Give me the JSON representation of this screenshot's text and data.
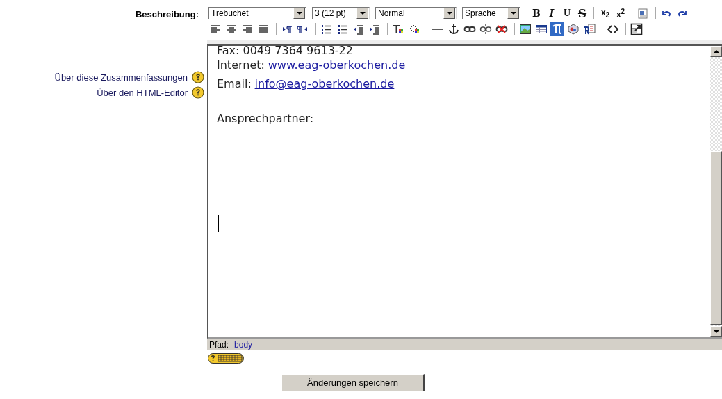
{
  "description_label": "Beschreibung:",
  "help_links": [
    {
      "label": "Über diese Zusammenfassungen"
    },
    {
      "label": "Über den HTML-Editor"
    }
  ],
  "editor": {
    "font": "Trebuchet",
    "size": "3 (12 pt)",
    "format": "Normal",
    "language": "Sprache",
    "format_buttons": [
      "B",
      "I",
      "U",
      "S"
    ],
    "script_buttons": [
      "x$_{2}$",
      "x$^{2}$"
    ],
    "special_char_active": true,
    "content": [
      {
        "kind": "text",
        "text": "Fax: 0049 7364 9613-22"
      },
      {
        "kind": "link",
        "label": "Internet:",
        "link": "www.eag-oberkochen.de"
      },
      {
        "kind": "link",
        "label": "Email:",
        "link": "info@eag-oberkochen.de"
      },
      {
        "kind": "blank"
      },
      {
        "kind": "text",
        "text": "Ansprechpartner:"
      }
    ],
    "path_label": "Pfad:",
    "path": "body"
  },
  "save_button": "Änderungen speichern"
}
